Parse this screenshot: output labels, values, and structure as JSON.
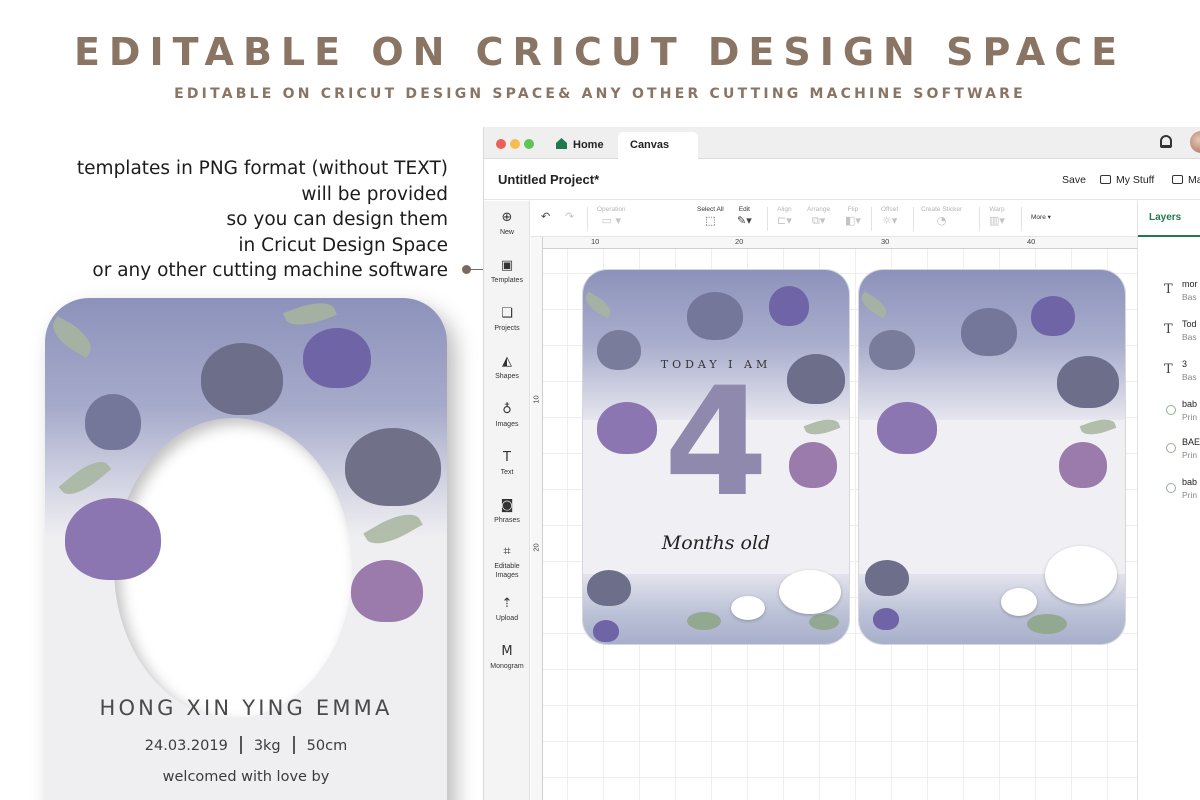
{
  "header": {
    "title": "EDITABLE ON CRICUT DESIGN SPACE",
    "subtitle": "EDITABLE ON CRICUT DESIGN SPACE& ANY OTHER CUTTING MACHINE SOFTWARE"
  },
  "features": [
    "templates in PNG format (without TEXT)",
    "will be provided",
    "so you can design them",
    "in Cricut Design Space",
    "or any other cutting machine software"
  ],
  "card": {
    "name": "HONG XIN YING EMMA",
    "date": "24.03.2019",
    "weight": "3kg",
    "length": "50cm",
    "welcome": "welcomed with love by"
  },
  "app": {
    "tabs": {
      "home": "Home",
      "canvas": "Canvas"
    },
    "project_title": "Untitled Project*",
    "save": "Save",
    "my_stuff": "My Stuff",
    "make": "Ma",
    "sidebar": [
      {
        "label": "New",
        "icon": "plus-circle-icon"
      },
      {
        "label": "Templates",
        "icon": "shirt-icon"
      },
      {
        "label": "Projects",
        "icon": "projects-icon"
      },
      {
        "label": "Shapes",
        "icon": "shapes-icon"
      },
      {
        "label": "Images",
        "icon": "bulb-icon"
      },
      {
        "label": "Text",
        "icon": "text-icon"
      },
      {
        "label": "Phrases",
        "icon": "speech-icon"
      },
      {
        "label": "Editable Images",
        "icon": "editable-images-icon"
      },
      {
        "label": "Upload",
        "icon": "upload-icon"
      },
      {
        "label": "Monogram",
        "icon": "monogram-icon"
      }
    ],
    "toolbar": {
      "operation": "Operation",
      "select_all": "Select All",
      "edit": "Edit",
      "align": "Align",
      "arrange": "Arrange",
      "flip": "Flip",
      "offset": "Offset",
      "create_sticker": "Create Sticker",
      "warp": "Warp",
      "more": "More"
    },
    "ruler_top": [
      "10",
      "20",
      "30",
      "40"
    ],
    "ruler_left": [
      "10",
      "20"
    ],
    "layers": {
      "tab": "Layers",
      "items": [
        {
          "name": "mor",
          "sub": "Bas",
          "icon": "text-layer-icon"
        },
        {
          "name": "Tod",
          "sub": "Bas",
          "icon": "text-layer-icon"
        },
        {
          "name": "3",
          "sub": "Bas",
          "icon": "text-layer-icon"
        },
        {
          "name": "bab",
          "sub": "Prin",
          "icon": "image-layer-icon"
        },
        {
          "name": "BAE",
          "sub": "Prin",
          "icon": "image-layer-icon"
        },
        {
          "name": "bab",
          "sub": "Prin",
          "icon": "image-layer-icon"
        }
      ]
    },
    "design": {
      "today": "TODAY I AM",
      "number": "4",
      "months": "Months old"
    }
  },
  "colors": {
    "heading": "#8a7463",
    "accent_green": "#1f7a4d",
    "number_purple": "#8e89ad"
  }
}
